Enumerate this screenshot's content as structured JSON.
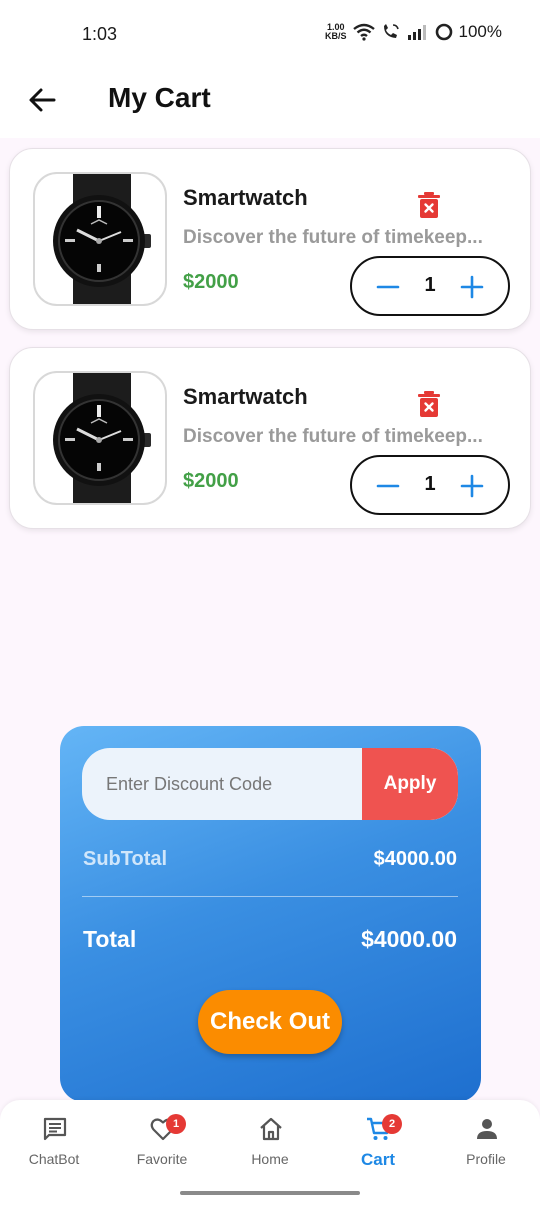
{
  "status_bar": {
    "time": "1:03",
    "net_speed_value": "1.00",
    "net_speed_unit": "KB/S",
    "battery": "100%"
  },
  "header": {
    "title": "My Cart"
  },
  "cart": {
    "items": [
      {
        "name": "Smartwatch",
        "description": "Discover the future of timekeep...",
        "price": "$2000",
        "quantity": "1"
      },
      {
        "name": "Smartwatch",
        "description": "Discover the future of timekeep...",
        "price": "$2000",
        "quantity": "1"
      }
    ]
  },
  "summary": {
    "discount_placeholder": "Enter Discount Code",
    "apply_label": "Apply",
    "subtotal_label": "SubTotal",
    "subtotal_value": "$4000.00",
    "total_label": "Total",
    "total_value": "$4000.00",
    "checkout_label": "Check Out"
  },
  "bottom_nav": {
    "items": [
      {
        "label": "ChatBot",
        "icon": "chat-icon"
      },
      {
        "label": "Favorite",
        "icon": "heart-icon",
        "badge": "1"
      },
      {
        "label": "Home",
        "icon": "home-icon"
      },
      {
        "label": "Cart",
        "icon": "cart-icon",
        "badge": "2",
        "active": true
      },
      {
        "label": "Profile",
        "icon": "person-icon"
      }
    ]
  },
  "colors": {
    "accent": "#1e88e5",
    "price": "#43a047",
    "delete": "#e53935",
    "apply": "#ef5350",
    "checkout": "#fb8c00"
  }
}
